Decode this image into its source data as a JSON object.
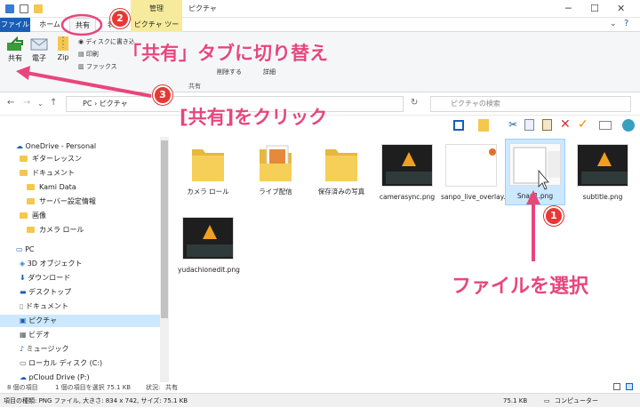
{
  "titlebar": {
    "context_header": "管理",
    "title": "ピクチャ"
  },
  "tabs": [
    {
      "label": "ファイル"
    },
    {
      "label": "ホーム"
    },
    {
      "label": "共有"
    },
    {
      "label": "表示"
    },
    {
      "label": "ピクチャ ツール"
    }
  ],
  "ribbon": {
    "share_label": "共有",
    "email_label": "電子",
    "zip_label": "Zip",
    "burn_label": "ディスクに書き込",
    "print_label": "印刷",
    "fax_label": "ファックス",
    "remove_access_label": "削除する",
    "advanced_label": "詳細",
    "group_label": "共有"
  },
  "address": {
    "path_pc": "PC",
    "path_pictures": "ピクチャ",
    "search_placeholder": "ピクチャの検索"
  },
  "nav": {
    "items": [
      {
        "label": "OneDrive - Personal"
      },
      {
        "label": "ギターレッスン"
      },
      {
        "label": "ドキュメント"
      },
      {
        "label": "Kami Data"
      },
      {
        "label": "サーバー設定情報"
      },
      {
        "label": "画像"
      },
      {
        "label": "カメラ ロール"
      },
      {
        "label": "PC"
      },
      {
        "label": "3D オブジェクト"
      },
      {
        "label": "ダウンロード"
      },
      {
        "label": "デスクトップ"
      },
      {
        "label": "ドキュメント"
      },
      {
        "label": "ピクチャ"
      },
      {
        "label": "ビデオ"
      },
      {
        "label": "ミュージック"
      },
      {
        "label": "ローカル ディスク (C:)"
      },
      {
        "label": "pCloud Drive (P:)"
      }
    ]
  },
  "files": [
    {
      "name": "カメラ ロール",
      "kind": "folder"
    },
    {
      "name": "ライブ配信",
      "kind": "folder"
    },
    {
      "name": "保存済みの写真",
      "kind": "folder"
    },
    {
      "name": "camerasync.png",
      "kind": "image"
    },
    {
      "name": "sanpo_live_overlay.png",
      "kind": "image"
    },
    {
      "name": "Snap1.png",
      "kind": "image"
    },
    {
      "name": "subtitle.png",
      "kind": "image"
    },
    {
      "name": "yudachionedit.png",
      "kind": "image"
    }
  ],
  "status": {
    "count": "8 個の項目",
    "selected": "1 個の項目を選択  75.1 KB",
    "state_label": "状況:",
    "state_value": "共有"
  },
  "bottom": {
    "details": "項目の種類: PNG ファイル, 大きさ: 834 x 742, サイズ: 75.1 KB",
    "size": "75.1 KB",
    "location": "コンピューター"
  },
  "annotations": {
    "step1": "1",
    "step2": "2",
    "step3": "3",
    "tab_hint": "「共有」タブに切り替え",
    "click_hint": "[共有]をクリック",
    "select_hint": "ファイルを選択"
  },
  "colors": {
    "accent": "#e8467c",
    "file_tab": "#1a5fb4",
    "context": "#f6eb9c",
    "selected": "#cce8ff"
  }
}
